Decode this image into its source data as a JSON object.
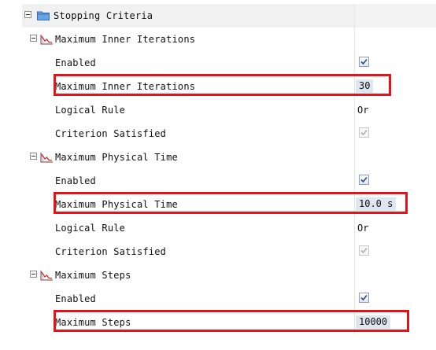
{
  "root": {
    "label": "Stopping Criteria",
    "icon": "folder-icon"
  },
  "groups": [
    {
      "label": "Maximum Inner Iterations",
      "icon": "stopping-criterion-graph-icon",
      "rows": [
        {
          "label": "Enabled",
          "kind": "checkbox",
          "checked": true,
          "disabled": false
        },
        {
          "label": "Maximum Inner Iterations",
          "kind": "value",
          "value": "30",
          "highlighted": true
        },
        {
          "label": "Logical Rule",
          "kind": "value",
          "value": "Or"
        },
        {
          "label": "Criterion Satisfied",
          "kind": "checkbox",
          "checked": true,
          "disabled": true
        }
      ]
    },
    {
      "label": "Maximum Physical Time",
      "icon": "stopping-criterion-graph-icon",
      "rows": [
        {
          "label": "Enabled",
          "kind": "checkbox",
          "checked": true,
          "disabled": false
        },
        {
          "label": "Maximum Physical Time",
          "kind": "value",
          "value": "10.0 s",
          "highlighted": true
        },
        {
          "label": "Logical Rule",
          "kind": "value",
          "value": "Or"
        },
        {
          "label": "Criterion Satisfied",
          "kind": "checkbox",
          "checked": true,
          "disabled": true
        }
      ]
    },
    {
      "label": "Maximum Steps",
      "icon": "stopping-criterion-graph-icon",
      "rows": [
        {
          "label": "Enabled",
          "kind": "checkbox",
          "checked": true,
          "disabled": false
        },
        {
          "label": "Maximum Steps",
          "kind": "value",
          "value": "10000",
          "highlighted": true
        }
      ]
    }
  ],
  "colors": {
    "annotation_red": "#e0141a",
    "folder_blue": "#2f6fbf",
    "graph_red": "#d23030",
    "category_gray": "#f1f1f1",
    "value_highlight": "#dfe6f0"
  }
}
